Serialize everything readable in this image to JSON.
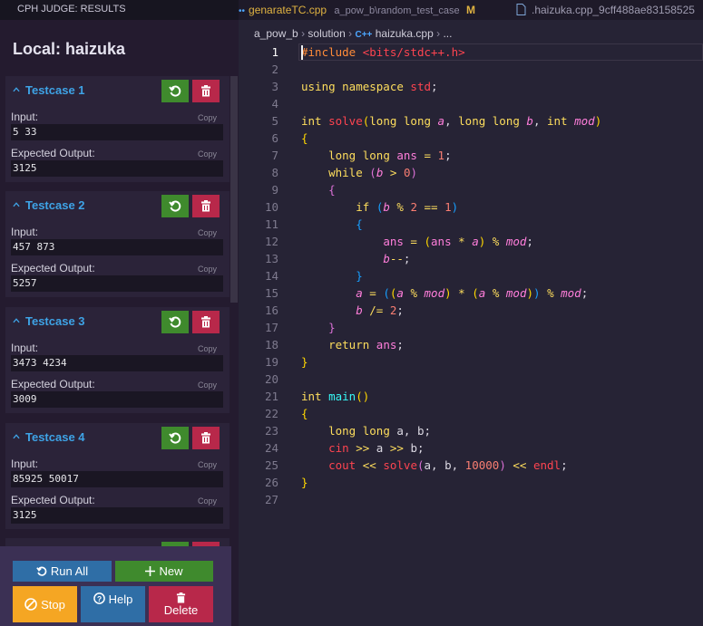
{
  "panel": {
    "header_title": "CPH JUDGE: RESULTS",
    "local_title": "Local: haizuka",
    "copy_label": "Copy",
    "testcases": [
      {
        "title": "Testcase 1",
        "input_label": "Input:",
        "input": "5 33",
        "output_label": "Expected Output:",
        "output": "3125"
      },
      {
        "title": "Testcase 2",
        "input_label": "Input:",
        "input": "457 873",
        "output_label": "Expected Output:",
        "output": "5257"
      },
      {
        "title": "Testcase 3",
        "input_label": "Input:",
        "input": "3473 4234",
        "output_label": "Expected Output:",
        "output": "3009"
      },
      {
        "title": "Testcase 4",
        "input_label": "Input:",
        "input": "85925 50017",
        "output_label": "Expected Output:",
        "output": "3125"
      }
    ],
    "buttons": {
      "run_all": "Run All",
      "new": "New",
      "stop": "Stop",
      "help": "Help",
      "delete": "Delete"
    },
    "colors": {
      "green": "#3f8a2d",
      "red": "#b8284a",
      "blue": "#2f6ea6",
      "orange": "#f5a623"
    }
  },
  "tabs": [
    {
      "name": "genarateTC.cpp",
      "path": "a_pow_b\\random_test_case",
      "status": "M"
    },
    {
      "name": ".haizuka.cpp_9cff488ae83158525"
    }
  ],
  "breadcrumb": {
    "folder1": "a_pow_b",
    "folder2": "solution",
    "icon": "C++",
    "file": "haizuka.cpp",
    "rest": "..."
  },
  "editor": {
    "current_line": 1,
    "line_numbers": [
      "1",
      "2",
      "3",
      "4",
      "5",
      "6",
      "7",
      "8",
      "9",
      "10",
      "11",
      "12",
      "13",
      "14",
      "15",
      "16",
      "17",
      "18",
      "19",
      "20",
      "21",
      "22",
      "23",
      "24",
      "25",
      "26",
      "27"
    ]
  }
}
